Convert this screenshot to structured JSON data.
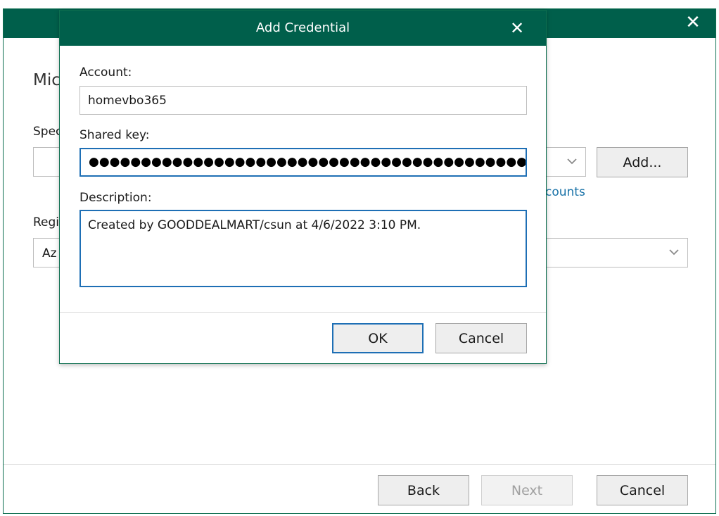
{
  "background_window": {
    "close_glyph": "✕",
    "heading_partial": "Mic",
    "specify_label_partial": "Spec",
    "region_label_partial": "Regi",
    "region_value_partial": "Az",
    "add_button_label": "Add...",
    "accounts_link_partial": "counts",
    "footer": {
      "back_label": "Back",
      "next_label": "Next",
      "cancel_label": "Cancel"
    }
  },
  "dialog": {
    "title": "Add Credential",
    "close_glyph": "✕",
    "account": {
      "label": "Account:",
      "value": "homevbo365"
    },
    "shared_key": {
      "label": "Shared key:",
      "masked_value": "●●●●●●●●●●●●●●●●●●●●●●●●●●●●●●●●●●●●●●●●●●●●●●●●●●●●●●●●●●"
    },
    "description": {
      "label": "Description:",
      "value": "Created by GOODDEALMART/csun at 4/6/2022 3:10 PM."
    },
    "ok_label": "OK",
    "cancel_label": "Cancel"
  },
  "colors": {
    "titlebar": "#005f4b",
    "focus_border": "#1e6fb5",
    "link": "#1a73a8"
  }
}
